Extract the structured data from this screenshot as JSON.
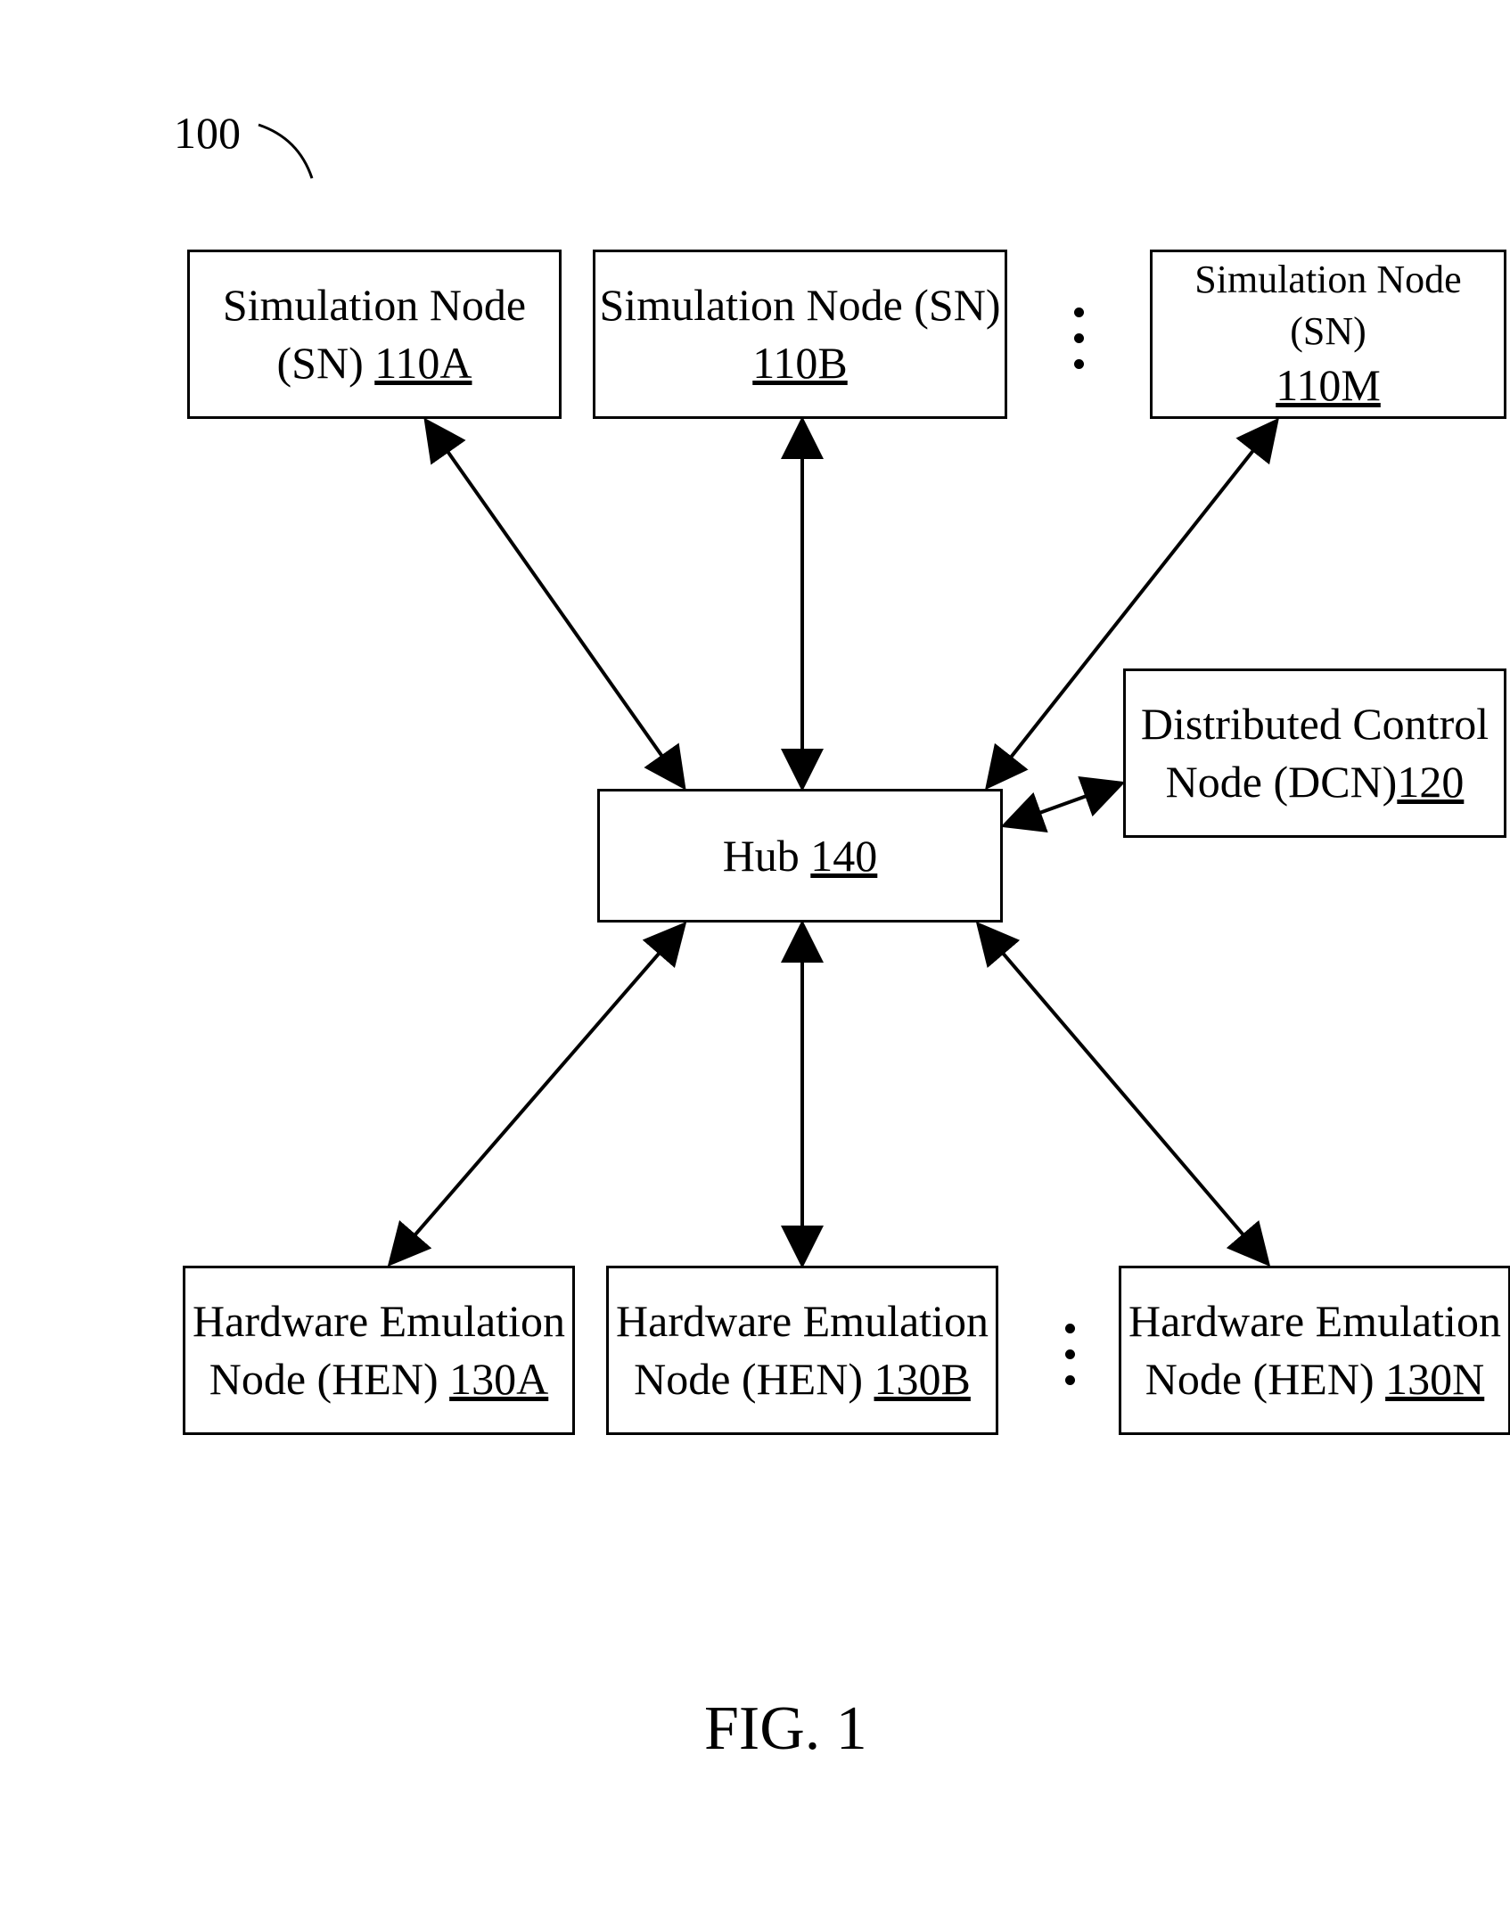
{
  "system_label": "100",
  "figure_label": "FIG. 1",
  "hub": {
    "label": "Hub",
    "ref": "140"
  },
  "sn_a": {
    "line1": "Simulation Node",
    "line2_prefix": "(SN) ",
    "ref": "110A"
  },
  "sn_b": {
    "line1": "Simulation Node (SN)",
    "ref": "110B"
  },
  "sn_m": {
    "line1": "Simulation Node  (SN)",
    "ref": "110M"
  },
  "dcn": {
    "line1": "Distributed Control",
    "line2_prefix": "Node (DCN)",
    "ref": "120"
  },
  "hen_a": {
    "line1": "Hardware Emulation",
    "line2_prefix": "Node (HEN) ",
    "ref": "130A"
  },
  "hen_b": {
    "line1": "Hardware Emulation",
    "line2_prefix": "Node (HEN) ",
    "ref": "130B"
  },
  "hen_n": {
    "line1": "Hardware Emulation",
    "line2_prefix": "Node (HEN) ",
    "ref": "130N"
  }
}
